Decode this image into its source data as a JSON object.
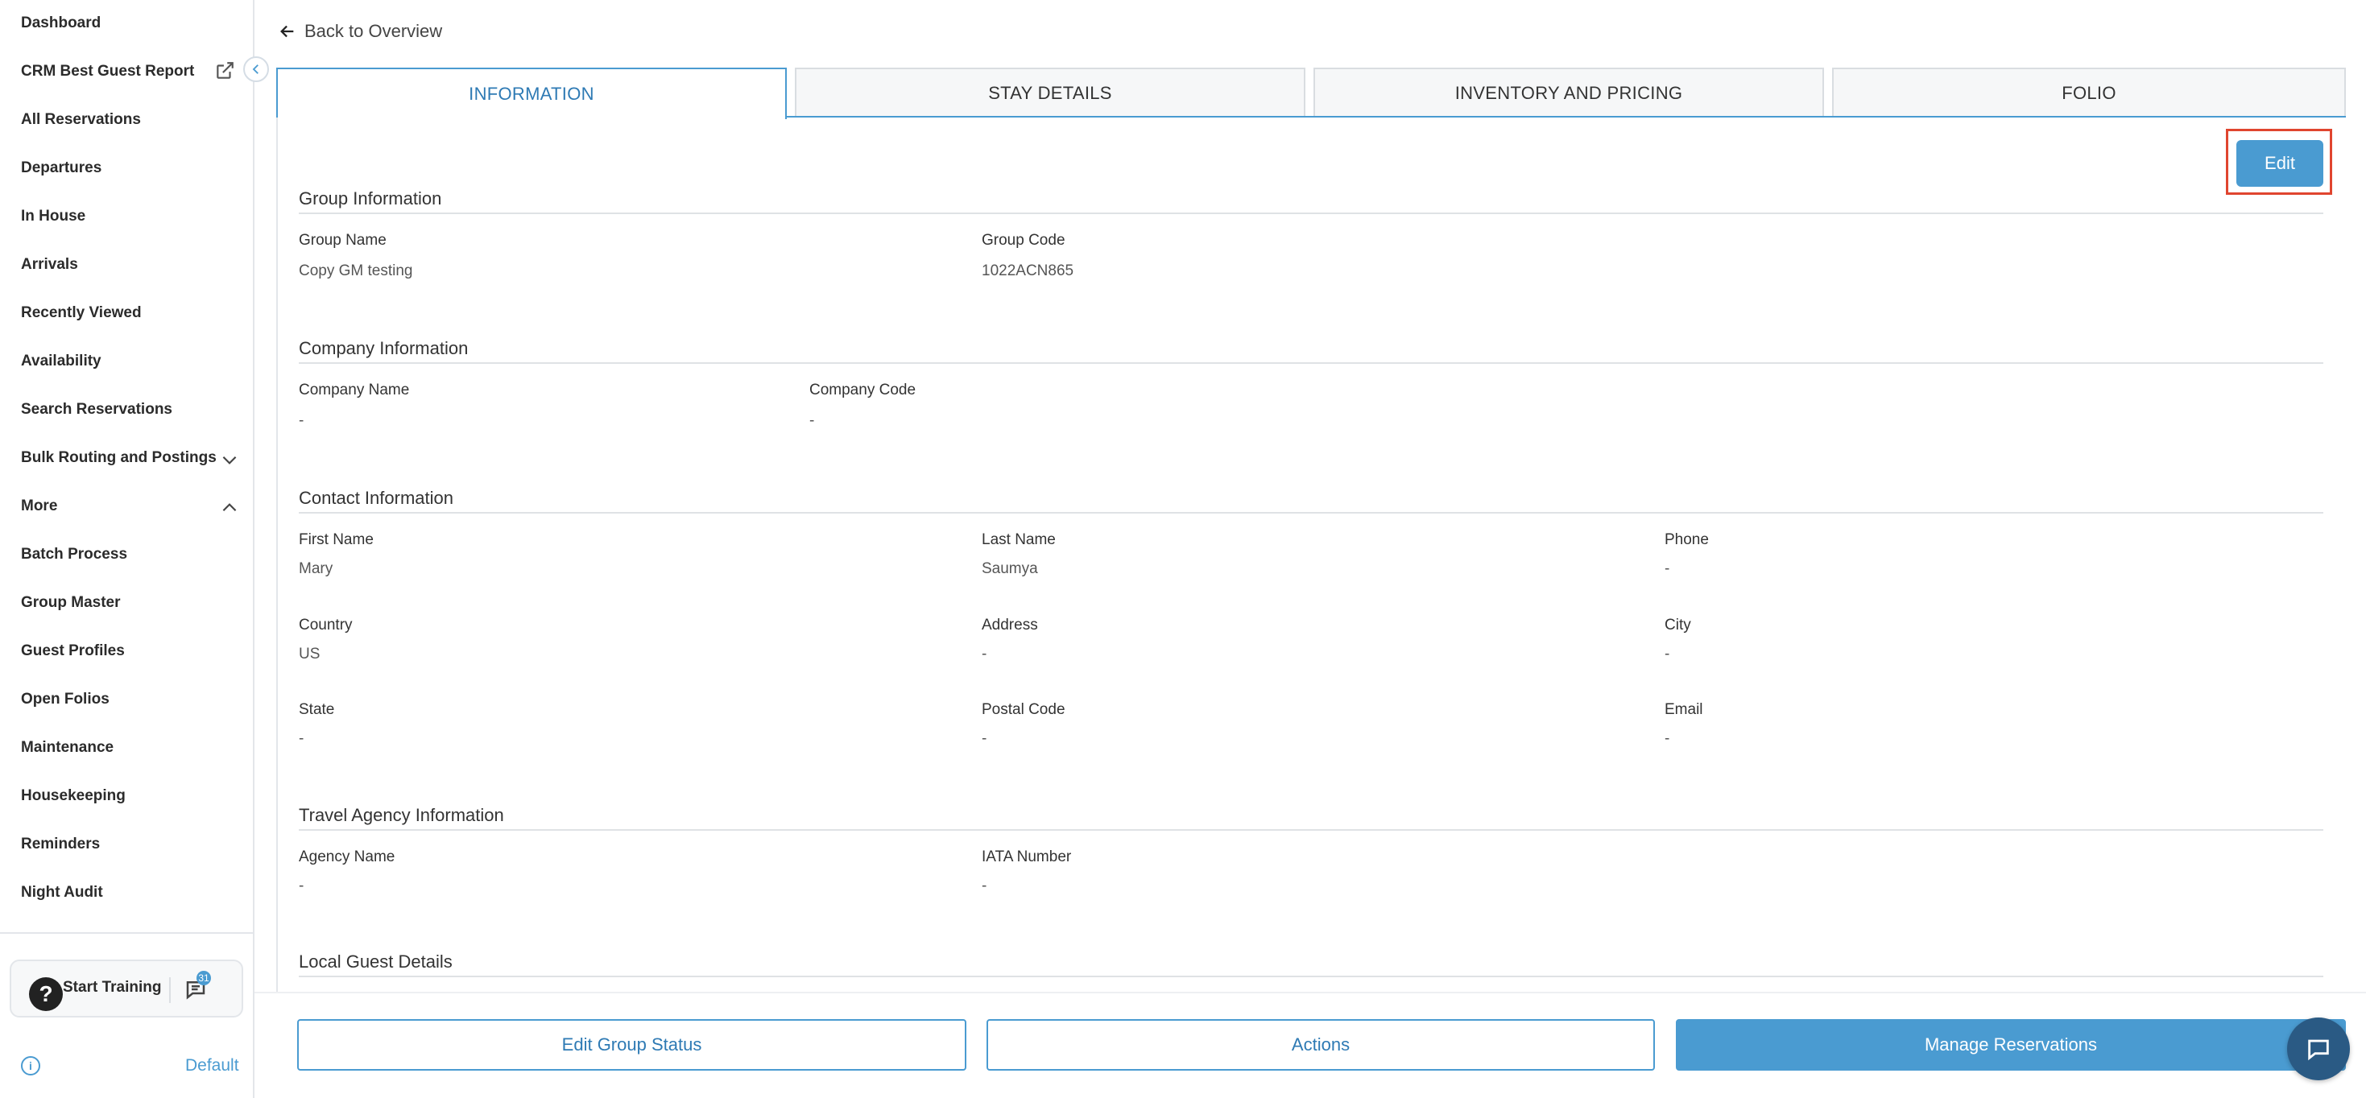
{
  "sidebar": {
    "items": [
      {
        "label": "Dashboard"
      },
      {
        "label": "CRM Best Guest Report"
      },
      {
        "label": "All Reservations"
      },
      {
        "label": "Departures"
      },
      {
        "label": "In House"
      },
      {
        "label": "Arrivals"
      },
      {
        "label": "Recently Viewed"
      },
      {
        "label": "Availability"
      },
      {
        "label": "Search Reservations"
      },
      {
        "label": "Bulk Routing and Postings"
      },
      {
        "label": "More"
      },
      {
        "label": "Batch Process"
      },
      {
        "label": "Group Master"
      },
      {
        "label": "Guest Profiles"
      },
      {
        "label": "Open Folios"
      },
      {
        "label": "Maintenance"
      },
      {
        "label": "Housekeeping"
      },
      {
        "label": "Reminders"
      },
      {
        "label": "Night Audit"
      }
    ],
    "help_glyph": "?",
    "start_training": "Start Training",
    "chat_badge": "31",
    "info_glyph": "i",
    "profile_label": "Default"
  },
  "header": {
    "back_label": "Back to Overview"
  },
  "tabs": [
    {
      "label": "INFORMATION"
    },
    {
      "label": "STAY DETAILS"
    },
    {
      "label": "INVENTORY AND PRICING"
    },
    {
      "label": "FOLIO"
    }
  ],
  "edit_label": "Edit",
  "group_info": {
    "title": "Group Information",
    "group_name_label": "Group Name",
    "group_name": "Copy GM testing",
    "group_code_label": "Group Code",
    "group_code": "1022ACN865"
  },
  "company_info": {
    "title": "Company Information",
    "company_name_label": "Company Name",
    "company_name": "-",
    "company_code_label": "Company Code",
    "company_code": "-"
  },
  "contact_info": {
    "title": "Contact Information",
    "first_name_label": "First Name",
    "first_name": "Mary",
    "last_name_label": "Last Name",
    "last_name": "Saumya",
    "phone_label": "Phone",
    "phone": "-",
    "country_label": "Country",
    "country": "US",
    "address_label": "Address",
    "address": "-",
    "city_label": "City",
    "city": "-",
    "state_label": "State",
    "state": "-",
    "postal_label": "Postal Code",
    "postal": "-",
    "email_label": "Email",
    "email": "-"
  },
  "travel_agency": {
    "title": "Travel Agency Information",
    "agency_name_label": "Agency Name",
    "agency_name": "-",
    "iata_label": "IATA Number",
    "iata": "-"
  },
  "local_guest": {
    "title": "Local Guest Details"
  },
  "footer": {
    "edit_status": "Edit Group Status",
    "actions": "Actions",
    "manage": "Manage Reservations"
  },
  "colors": {
    "accent": "#4a9bd1",
    "highlight": "#e0452f",
    "chat_fab": "#2a5a84"
  },
  "icons": {
    "back": "arrow-left-icon",
    "external": "external-link-icon",
    "collapse": "chevron-left-icon",
    "expand": "chevron-down-icon",
    "collapse_section": "chevron-up-icon",
    "help": "question-icon",
    "chat": "chat-icon",
    "info": "info-icon"
  }
}
